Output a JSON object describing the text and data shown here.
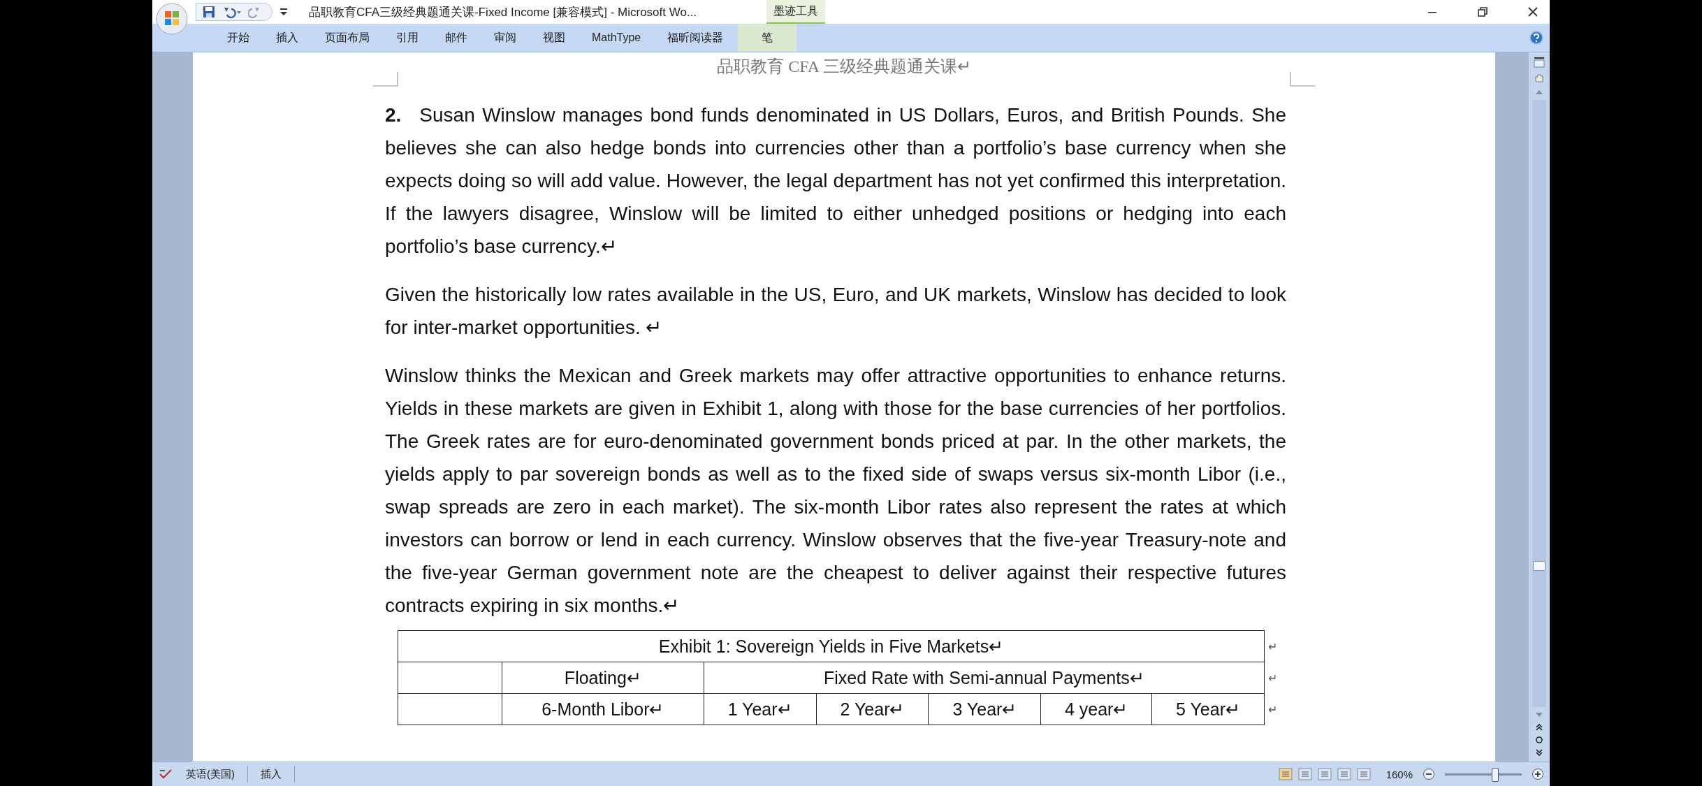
{
  "window": {
    "title": "品职教育CFA三级经典题通关课-Fixed Income [兼容模式] - Microsoft Wo...",
    "context_tab": "墨迹工具"
  },
  "ribbon_tabs": [
    {
      "label": "开始",
      "selected": false
    },
    {
      "label": "插入",
      "selected": false
    },
    {
      "label": "页面布局",
      "selected": false
    },
    {
      "label": "引用",
      "selected": false
    },
    {
      "label": "邮件",
      "selected": false
    },
    {
      "label": "审阅",
      "selected": false
    },
    {
      "label": "视图",
      "selected": false
    },
    {
      "label": "MathType",
      "selected": false
    },
    {
      "label": "福昕阅读器",
      "selected": false
    },
    {
      "label": "笔",
      "selected": false
    }
  ],
  "document": {
    "header": "品职教育 CFA 三级经典题通关课↵",
    "paragraphs": [
      {
        "number": "2.",
        "text": "Susan Winslow manages bond funds denominated in US Dollars, Euros, and British Pounds. She believes she can also hedge bonds into currencies other than a portfolio’s base currency when she expects doing so will add value. However, the legal department has not yet confirmed this interpretation. If the lawyers disagree, Winslow will be limited to either unhedged positions or hedging into each portfolio’s base currency.↵"
      },
      {
        "text": "Given the historically low rates available in the US, Euro, and UK markets, Winslow has decided to look for inter-market opportunities.  ↵"
      },
      {
        "text": "Winslow thinks the Mexican and Greek markets may offer attractive opportunities to enhance returns. Yields in these markets are given in Exhibit 1, along with those for the base currencies of her portfolios. The Greek rates are for euro-denominated government bonds priced at par. In the other markets, the yields apply to par sovereign bonds as well as to the fixed side of swaps versus six-month Libor (i.e., swap spreads are zero in each market). The six-month Libor rates also represent the rates at which investors can borrow or lend in each currency. Winslow observes that the five-year Treasury-note and the five-year German government note are the cheapest to deliver against their respective futures contracts expiring in six months.↵"
      }
    ],
    "table": {
      "title": "Exhibit 1: Sovereign Yields in Five Markets↵",
      "group_headers": [
        "Floating↵",
        "Fixed Rate with Semi-annual Payments↵"
      ],
      "columns": [
        "6-Month Libor↵",
        "1 Year↵",
        "2 Year↵",
        "3 Year↵",
        "4 year↵",
        "5 Year↵"
      ],
      "row_end_mark": "↵"
    }
  },
  "status_bar": {
    "language": "英语(美国)",
    "mode": "插入",
    "zoom": "160%",
    "level": 0.65
  }
}
